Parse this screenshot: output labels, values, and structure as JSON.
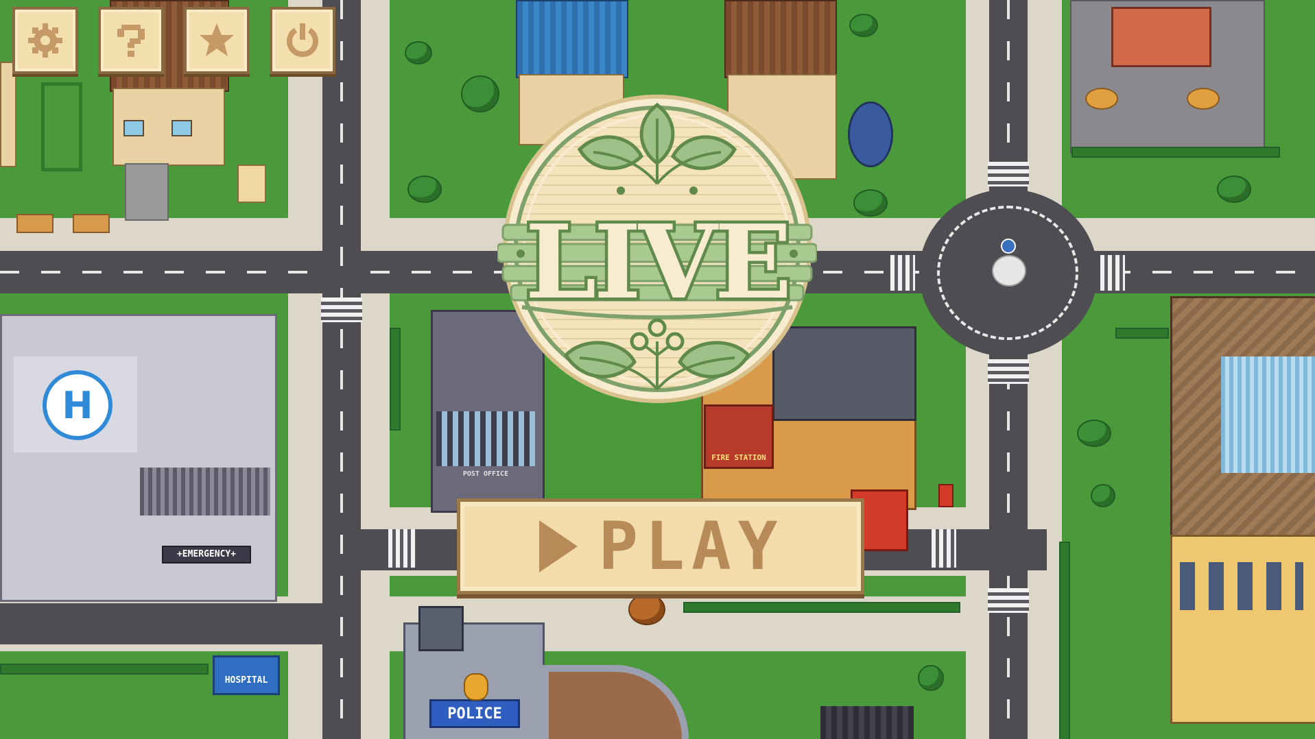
{
  "screen": "main-menu",
  "top_buttons": [
    {
      "name": "settings-button",
      "icon": "gear-icon"
    },
    {
      "name": "help-button",
      "icon": "question-mark-icon"
    },
    {
      "name": "favorites-button",
      "icon": "star-icon"
    },
    {
      "name": "quit-button",
      "icon": "power-icon"
    }
  ],
  "logo": {
    "text": "LIVE"
  },
  "play_button": {
    "label": "PLAY",
    "icon": "play-icon"
  },
  "map_signs": {
    "emergency": "+EMERGENCY+",
    "fire_station": "FIRE STATION",
    "post_office": "POST OFFICE",
    "hospital": "HOSPITAL",
    "police": "POLICE",
    "helipad": "H"
  },
  "colors": {
    "grass": "#4a9a3c",
    "road": "#4d4d52",
    "button_face": "#f3dfad",
    "button_border": "#8a6a45",
    "button_icon": "#c69a67",
    "logo_leaf": "#9ec18a",
    "logo_wood": "#f3e4bd"
  }
}
